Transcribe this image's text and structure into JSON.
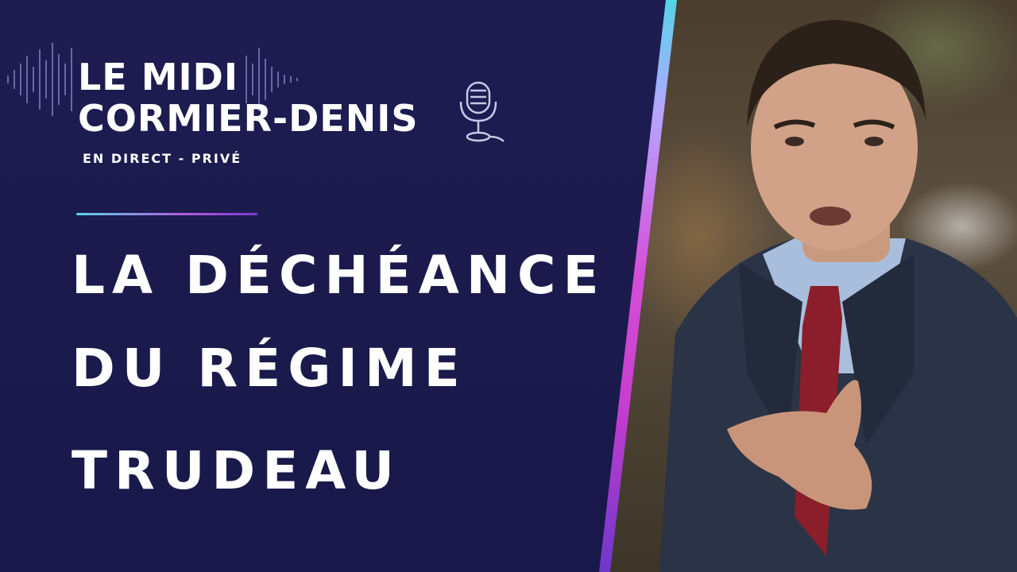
{
  "show": {
    "title_line1": "LE MIDI",
    "title_line2": "CORMIER-DENIS",
    "subtitle": "EN DIRECT - PRIVÉ"
  },
  "headline": {
    "line1": "LA DÉCHÉANCE",
    "line2": "DU RÉGIME",
    "line3": "TRUDEAU"
  },
  "icons": {
    "waveform": "audio-waveform-icon",
    "microphone": "microphone-icon"
  },
  "colors": {
    "background": "#1c1a4e",
    "text": "#ffffff",
    "accent_cyan": "#56d4e8",
    "accent_magenta": "#d64ed8",
    "accent_purple": "#6e37c9"
  }
}
